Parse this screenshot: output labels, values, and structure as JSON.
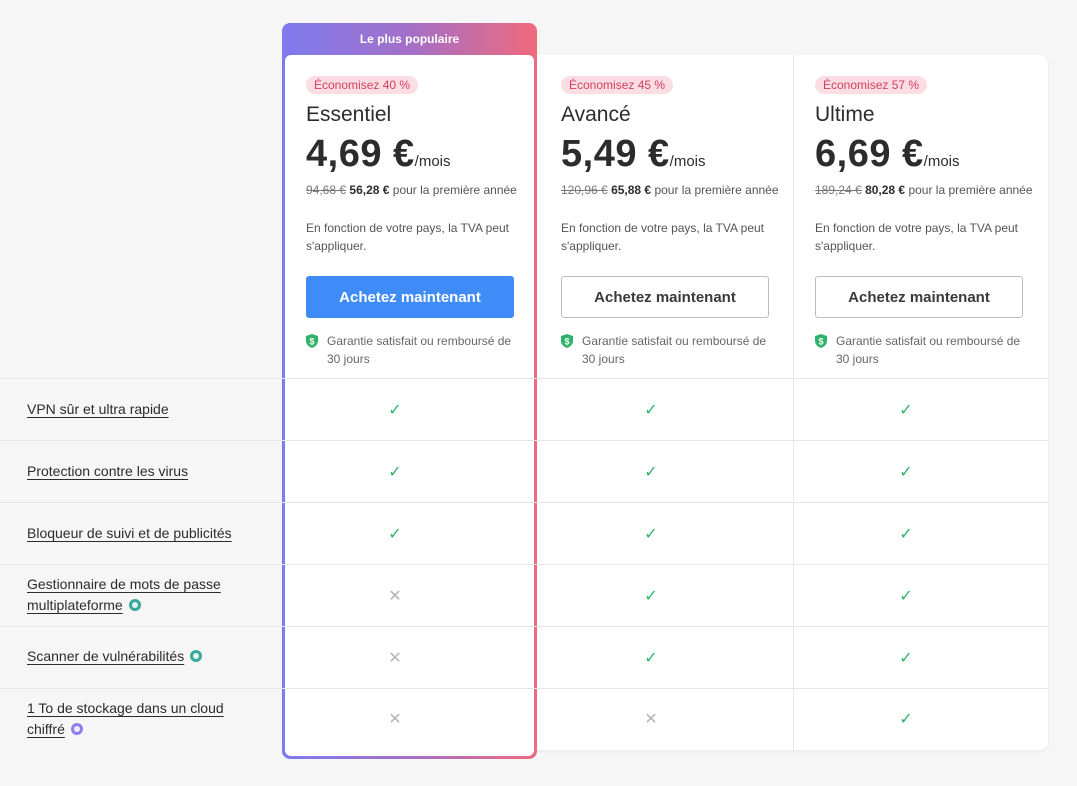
{
  "popular_label": "Le plus populaire",
  "plans": [
    {
      "badge": "Économisez 40 %",
      "name": "Essentiel",
      "price": "4,69 €",
      "per": "/mois",
      "old_price": "94,68 €",
      "new_price": "56,28 €",
      "period": "pour la première année",
      "vat": "En fonction de votre pays, la TVA peut s'appliquer.",
      "button": "Achetez maintenant",
      "guarantee": "Garantie satisfait ou remboursé de 30 jours"
    },
    {
      "badge": "Économisez 45 %",
      "name": "Avancé",
      "price": "5,49 €",
      "per": "/mois",
      "old_price": "120,96 €",
      "new_price": "65,88 €",
      "period": "pour la première année",
      "vat": "En fonction de votre pays, la TVA peut s'appliquer.",
      "button": "Achetez maintenant",
      "guarantee": "Garantie satisfait ou remboursé de 30 jours"
    },
    {
      "badge": "Économisez 57 %",
      "name": "Ultime",
      "price": "6,69 €",
      "per": "/mois",
      "old_price": "189,24 €",
      "new_price": "80,28 €",
      "period": "pour la première année",
      "vat": "En fonction de votre pays, la TVA peut s'appliquer.",
      "button": "Achetez maintenant",
      "guarantee": "Garantie satisfait ou remboursé de 30 jours"
    }
  ],
  "features": [
    {
      "label": "VPN sûr et ultra rapide",
      "icon": "",
      "included": [
        true,
        true,
        true
      ]
    },
    {
      "label": "Protection contre les virus",
      "icon": "",
      "included": [
        true,
        true,
        true
      ]
    },
    {
      "label": "Bloqueur de suivi et de publicités",
      "icon": "",
      "included": [
        true,
        true,
        true
      ]
    },
    {
      "label": "Gestionnaire de mots de passe multiplateforme",
      "icon": "password-manager-icon",
      "included": [
        false,
        true,
        true
      ]
    },
    {
      "label": "Scanner de vulnérabilités",
      "icon": "scanner-icon",
      "included": [
        false,
        true,
        true
      ]
    },
    {
      "label": "1 To de stockage dans un cloud chiffré",
      "icon": "cloud-storage-icon",
      "included": [
        false,
        false,
        true
      ]
    }
  ],
  "colors": {
    "accent": "#3f8cf8",
    "check": "#2fb36a",
    "badge_bg": "#fcdde3",
    "badge_text": "#d14062"
  }
}
